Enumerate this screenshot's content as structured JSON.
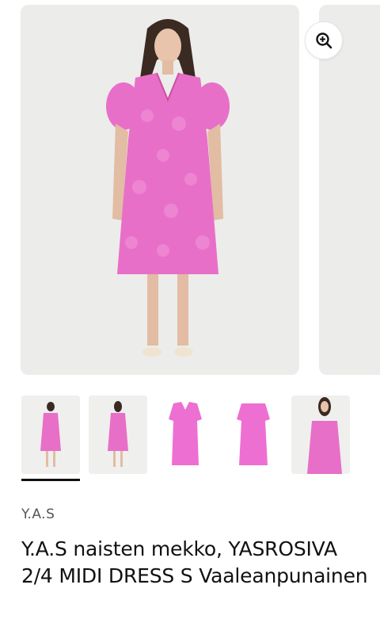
{
  "gallery": {
    "zoom_icon": "zoom-in-icon",
    "main_image_alt": "",
    "thumbnails": [
      {
        "name": "thumb-front-model"
      },
      {
        "name": "thumb-back-model"
      },
      {
        "name": "thumb-front-flat"
      },
      {
        "name": "thumb-back-flat"
      },
      {
        "name": "thumb-detail-model"
      }
    ],
    "selected_thumbnail": 1
  },
  "product": {
    "brand": "Y.A.S",
    "title": "Y.A.S naisten mekko, YASROSIVA 2/4 MIDI DRESS S Vaaleanpunainen"
  },
  "colors": {
    "dress_pink": "#e86fc8",
    "background_grey": "#ececea",
    "text": "#111111"
  }
}
